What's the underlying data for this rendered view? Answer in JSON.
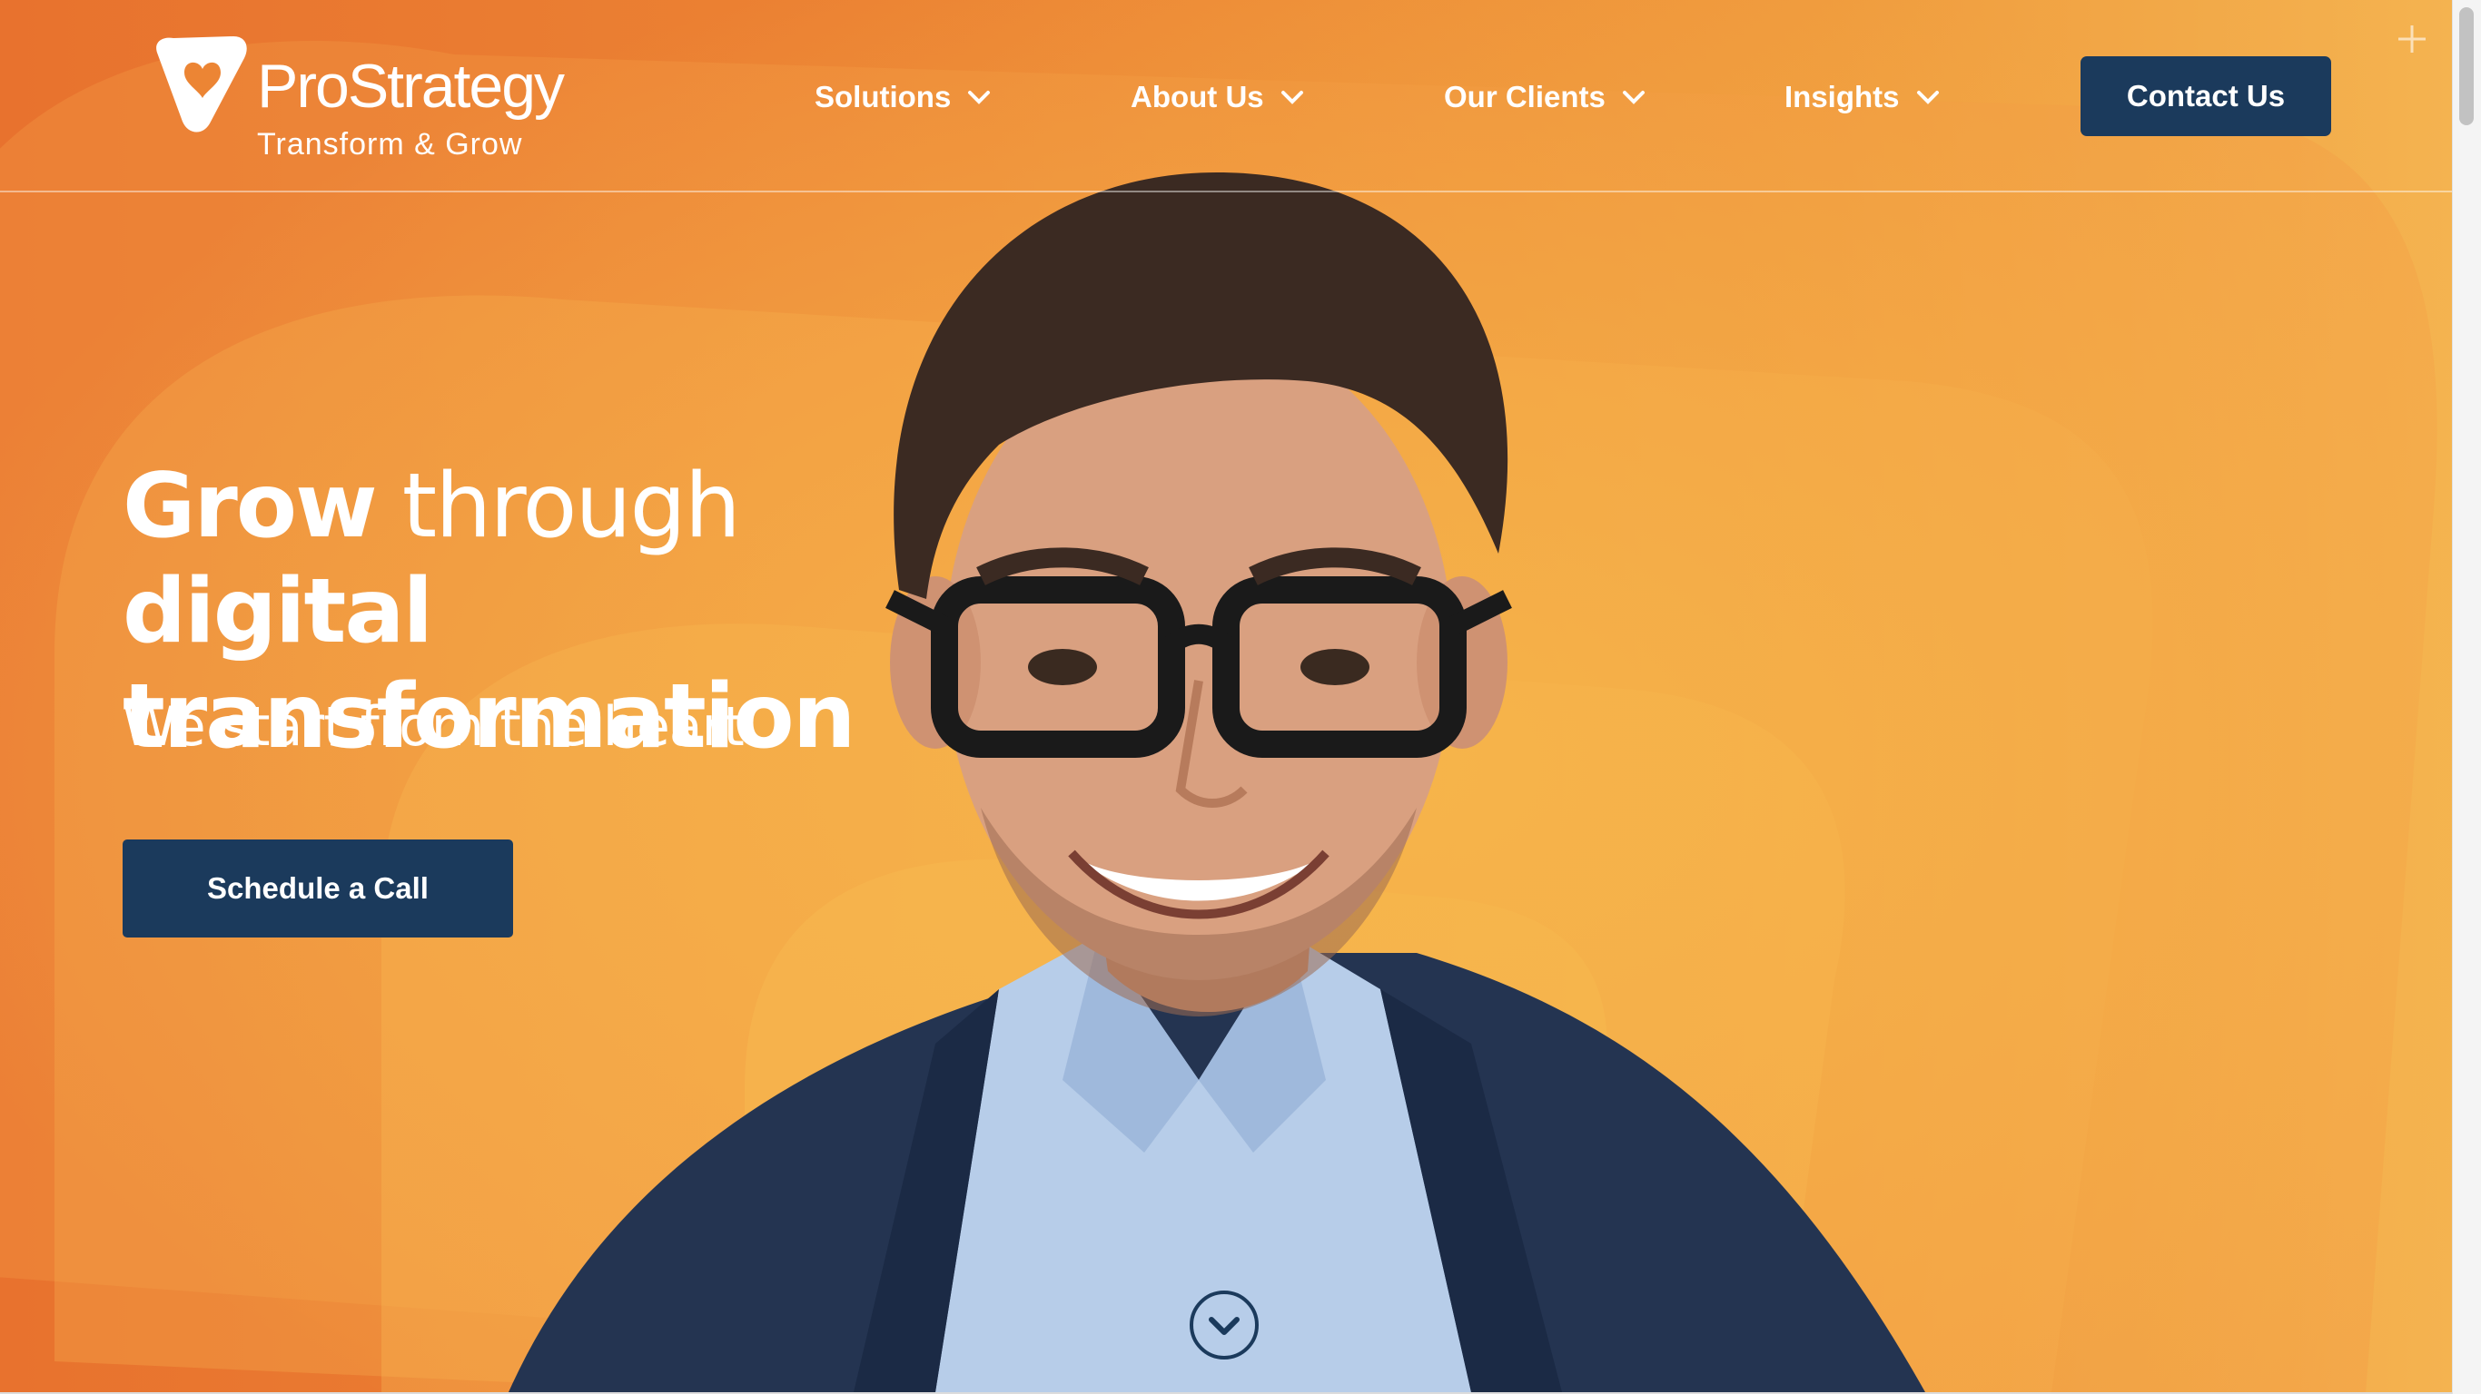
{
  "brand": {
    "name": "ProStrategy",
    "tagline": "Transform & Grow",
    "logo_icon": "triangle-heart-icon"
  },
  "nav": {
    "items": [
      {
        "label": "Solutions",
        "icon": "chevron-down-icon"
      },
      {
        "label": "About Us",
        "icon": "chevron-down-icon"
      },
      {
        "label": "Our Clients",
        "icon": "chevron-down-icon"
      },
      {
        "label": "Insights",
        "icon": "chevron-down-icon"
      }
    ],
    "contact_label": "Contact Us"
  },
  "hero": {
    "headline_word1": "Grow",
    "headline_word2": "through",
    "headline_word3": "digital",
    "headline_line2": "transformation",
    "subheadline": "We start from the heart.",
    "cta_label": "Schedule a Call",
    "scroll_icon": "chevron-down-circle-icon",
    "image": "smiling-man-with-glasses-portrait"
  },
  "colors": {
    "accent": "#ec8534",
    "button": "#1b3a5c",
    "text_light": "#ffffff"
  }
}
